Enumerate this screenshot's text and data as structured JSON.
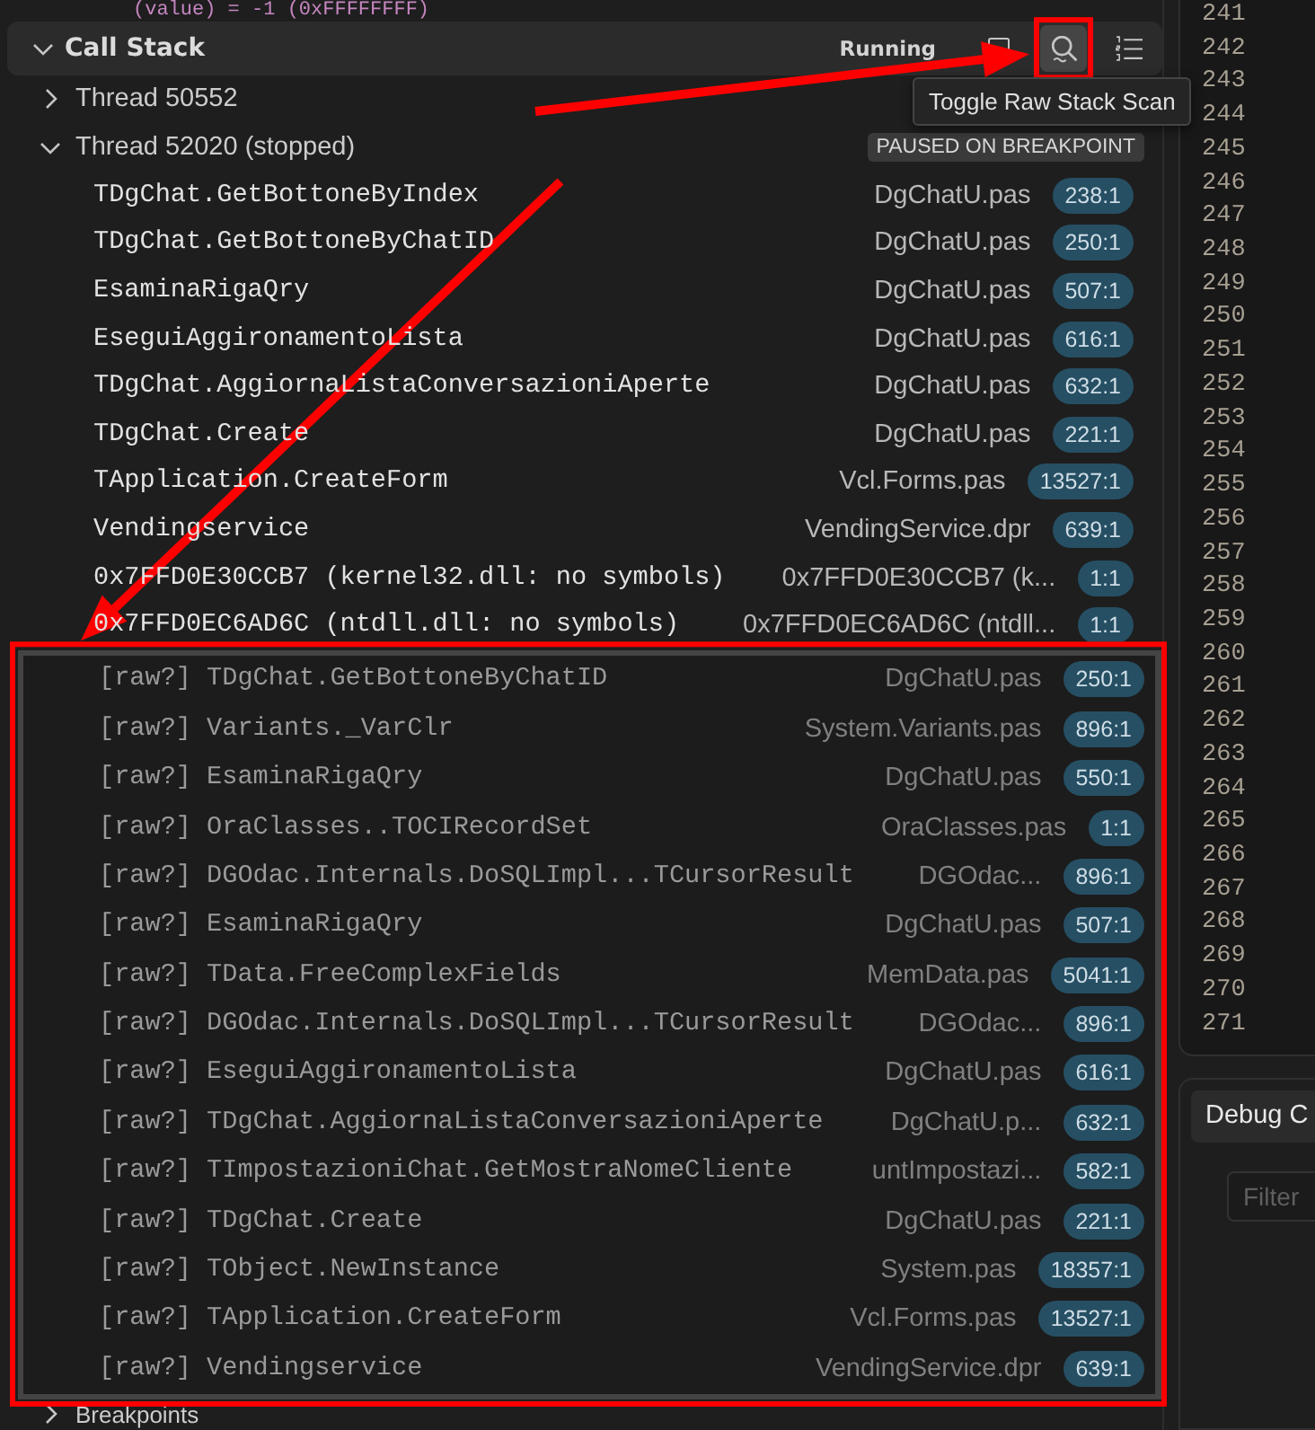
{
  "editor_peek": {
    "text": "(value) = -1  (0xFFFFFFFF)"
  },
  "call_stack": {
    "title": "Call Stack",
    "expanded": true,
    "status": "Running",
    "tooltip": "Toggle Raw Stack Scan",
    "toolbar": [
      {
        "kind": "collapse",
        "hovered": false
      },
      {
        "kind": "raw-scan",
        "hovered": true
      },
      {
        "kind": "numbered-list",
        "hovered": false
      }
    ],
    "threads": [
      {
        "name": "Thread 50552",
        "expanded": false
      },
      {
        "name": "Thread 52020 (stopped)",
        "expanded": true,
        "badge": "PAUSED ON BREAKPOINT",
        "frames": [
          {
            "kind": "frame",
            "name": "TDgChat.GetBottoneByIndex",
            "file": "DgChatU.pas",
            "position": "238:1"
          },
          {
            "kind": "frame",
            "name": "TDgChat.GetBottoneByChatID",
            "file": "DgChatU.pas",
            "position": "250:1"
          },
          {
            "kind": "frame",
            "name": "EsaminaRigaQry",
            "file": "DgChatU.pas",
            "position": "507:1"
          },
          {
            "kind": "frame",
            "name": "EseguiAggironamentoLista",
            "file": "DgChatU.pas",
            "position": "616:1"
          },
          {
            "kind": "frame",
            "name": "TDgChat.AggiornaListaConversazioniAperte",
            "file": "DgChatU.pas",
            "position": "632:1"
          },
          {
            "kind": "frame",
            "name": "TDgChat.Create",
            "file": "DgChatU.pas",
            "position": "221:1"
          },
          {
            "kind": "frame",
            "name": "TApplication.CreateForm",
            "file": "Vcl.Forms.pas",
            "position": "13527:1"
          },
          {
            "kind": "frame",
            "name": "Vendingservice",
            "file": "VendingService.dpr",
            "position": "639:1"
          },
          {
            "kind": "frame",
            "name": "0x7FFD0E30CCB7 (kernel32.dll: no symbols)",
            "file": "0x7FFD0E30CCB7 (k...",
            "position": "1:1"
          },
          {
            "kind": "frame",
            "name": "0x7FFD0EC6AD6C (ntdll.dll: no symbols)",
            "file": "0x7FFD0EC6AD6C (ntdll...",
            "position": "1:1"
          },
          {
            "kind": "raw",
            "name": "[raw?] TDgChat.GetBottoneByChatID",
            "file": "DgChatU.pas",
            "position": "250:1"
          },
          {
            "kind": "raw",
            "name": "[raw?] Variants._VarClr",
            "file": "System.Variants.pas",
            "position": "896:1"
          },
          {
            "kind": "raw",
            "name": "[raw?] EsaminaRigaQry",
            "file": "DgChatU.pas",
            "position": "550:1"
          },
          {
            "kind": "raw",
            "name": "[raw?] OraClasses..TOCIRecordSet",
            "file": "OraClasses.pas",
            "position": "1:1"
          },
          {
            "kind": "raw",
            "name": "[raw?] DGOdac.Internals.DoSQLImpl...TCursorResult",
            "file": "DGOdac...",
            "position": "896:1"
          },
          {
            "kind": "raw",
            "name": "[raw?] EsaminaRigaQry",
            "file": "DgChatU.pas",
            "position": "507:1"
          },
          {
            "kind": "raw",
            "name": "[raw?] TData.FreeComplexFields",
            "file": "MemData.pas",
            "position": "5041:1"
          },
          {
            "kind": "raw",
            "name": "[raw?] DGOdac.Internals.DoSQLImpl...TCursorResult",
            "file": "DGOdac...",
            "position": "896:1"
          },
          {
            "kind": "raw",
            "name": "[raw?] EseguiAggironamentoLista",
            "file": "DgChatU.pas",
            "position": "616:1"
          },
          {
            "kind": "raw",
            "name": "[raw?] TDgChat.AggiornaListaConversazioniAperte",
            "file": "DgChatU.p...",
            "position": "632:1"
          },
          {
            "kind": "raw",
            "name": "[raw?] TImpostazioniChat.GetMostraNomeCliente",
            "file": "untImpostazi...",
            "position": "582:1"
          },
          {
            "kind": "raw",
            "name": "[raw?] TDgChat.Create",
            "file": "DgChatU.pas",
            "position": "221:1"
          },
          {
            "kind": "raw",
            "name": "[raw?] TObject.NewInstance",
            "file": "System.pas",
            "position": "18357:1"
          },
          {
            "kind": "raw",
            "name": "[raw?] TApplication.CreateForm",
            "file": "Vcl.Forms.pas",
            "position": "13527:1"
          },
          {
            "kind": "raw",
            "name": "[raw?] Vendingservice",
            "file": "VendingService.dpr",
            "position": "639:1"
          }
        ]
      }
    ]
  },
  "breakpoints": {
    "title": "Breakpoints",
    "expanded": false
  },
  "line_numbers": [
    "241",
    "242",
    "243",
    "244",
    "245",
    "246",
    "247",
    "248",
    "249",
    "250",
    "251",
    "252",
    "253",
    "254",
    "255",
    "256",
    "257",
    "258",
    "259",
    "260",
    "261",
    "262",
    "263",
    "264",
    "265",
    "266",
    "267",
    "268",
    "269",
    "270",
    "271"
  ],
  "debug_console": {
    "title": "Debug C",
    "filter_placeholder": "Filter"
  }
}
